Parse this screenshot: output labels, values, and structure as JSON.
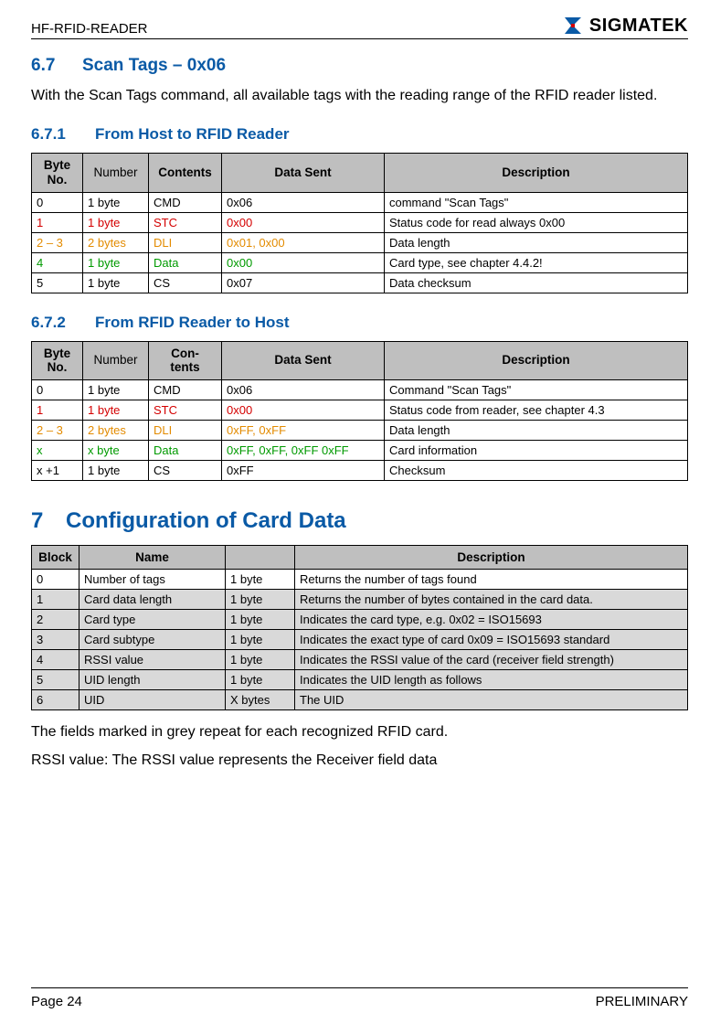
{
  "header": {
    "left": "HF-RFID-READER",
    "brand": "SIGMATEK"
  },
  "sec67": {
    "num": "6.7",
    "title": "Scan Tags – 0x06"
  },
  "intro": "With the Scan Tags command, all available tags with the reading range of the RFID reader listed.",
  "sub671": {
    "num": "6.7.1",
    "title": "From Host to RFID Reader"
  },
  "t1": {
    "cols": {
      "byte": "Byte\nNo.",
      "num": "Number",
      "con": "Contents",
      "sent": "Data Sent",
      "desc": "Description"
    },
    "rows": [
      {
        "byte": "0",
        "num": "1 byte",
        "con": "CMD",
        "sent": "0x06",
        "desc": "command \"Scan Tags\"",
        "cls": ""
      },
      {
        "byte": "1",
        "num": "1 byte",
        "con": "STC",
        "sent": "0x00",
        "desc": "Status code for read always 0x00",
        "cls": "row-red"
      },
      {
        "byte": "2 – 3",
        "num": "2 bytes",
        "con": "DLI",
        "sent": "0x01, 0x00",
        "desc": "Data length",
        "cls": "row-orange"
      },
      {
        "byte": "4",
        "num": "1 byte",
        "con": "Data",
        "sent": "0x00",
        "desc": "Card type, see chapter 4.4.2!",
        "cls": "row-green"
      },
      {
        "byte": "5",
        "num": "1 byte",
        "con": "CS",
        "sent": "0x07",
        "desc": "Data checksum",
        "cls": ""
      }
    ]
  },
  "sub672": {
    "num": "6.7.2",
    "title": "From RFID Reader to Host"
  },
  "t2": {
    "cols": {
      "byte": "Byte\nNo.",
      "num": "Number",
      "con": "Con-\ntents",
      "sent": "Data Sent",
      "desc": "Description"
    },
    "rows": [
      {
        "byte": "0",
        "num": "1 byte",
        "con": "CMD",
        "sent": "0x06",
        "desc": "Command \"Scan Tags\"",
        "cls": ""
      },
      {
        "byte": "1",
        "num": "1 byte",
        "con": "STC",
        "sent": "0x00",
        "desc": "Status code from reader, see chapter 4.3",
        "cls": "row-red"
      },
      {
        "byte": "2 – 3",
        "num": "2 bytes",
        "con": "DLI",
        "sent": "0xFF, 0xFF",
        "desc": "Data length",
        "cls": "row-orange"
      },
      {
        "byte": "x",
        "num": "x byte",
        "con": "Data",
        "sent": "0xFF, 0xFF, 0xFF 0xFF",
        "desc": "Card information",
        "cls": "row-green"
      },
      {
        "byte": "x +1",
        "num": "1 byte",
        "con": "CS",
        "sent": "0xFF",
        "desc": "Checksum",
        "cls": ""
      }
    ]
  },
  "chap7": {
    "num": "7",
    "title": "Configuration of Card Data"
  },
  "t3": {
    "cols": {
      "blk": "Block",
      "name": "Name",
      "sz": "",
      "desc": "Description"
    },
    "rows": [
      {
        "blk": "0",
        "name": "Number of tags",
        "sz": "1 byte",
        "desc": "Returns the number of tags found",
        "shade": false
      },
      {
        "blk": "1",
        "name": "Card data length",
        "sz": "1 byte",
        "desc": "Returns the number of bytes contained in the card data.",
        "shade": true
      },
      {
        "blk": "2",
        "name": "Card type",
        "sz": "1 byte",
        "desc": "Indicates the card type, e.g. 0x02 = ISO15693",
        "shade": true
      },
      {
        "blk": "3",
        "name": "Card subtype",
        "sz": "1 byte",
        "desc": "Indicates the exact type of card 0x09 = ISO15693 standard",
        "shade": true
      },
      {
        "blk": "4",
        "name": "RSSI value",
        "sz": "1 byte",
        "desc": "Indicates the RSSI value of the card (receiver field strength)",
        "shade": true
      },
      {
        "blk": "5",
        "name": "UID length",
        "sz": "1 byte",
        "desc": "Indicates the UID length as follows",
        "shade": true
      },
      {
        "blk": "6",
        "name": "UID",
        "sz": "X bytes",
        "desc": "The UID",
        "shade": true
      }
    ]
  },
  "note1": "The fields marked in grey repeat for each recognized RFID card.",
  "note2": "RSSI value: The RSSI value represents the Receiver field data",
  "footer": {
    "left": "Page 24",
    "right": "PRELIMINARY"
  }
}
